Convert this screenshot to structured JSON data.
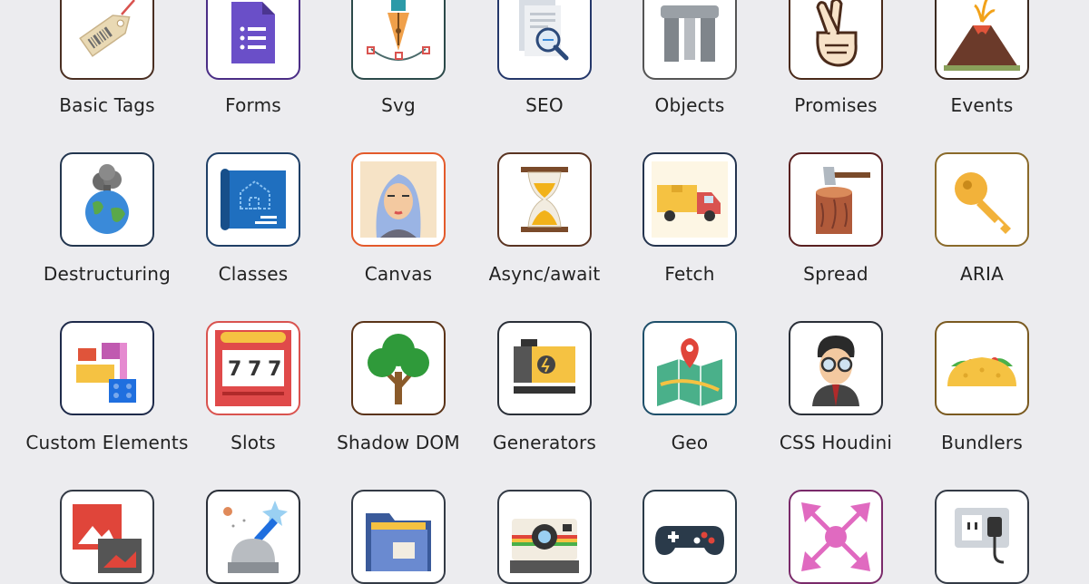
{
  "topics": [
    {
      "label": "Basic Tags",
      "icon": "price-tag-icon",
      "border": "#4a2f22"
    },
    {
      "label": "Forms",
      "icon": "form-document-icon",
      "border": "#4b2e86"
    },
    {
      "label": "Svg",
      "icon": "pen-nib-icon",
      "border": "#2c4a4a"
    },
    {
      "label": "SEO",
      "icon": "magnifier-document-icon",
      "border": "#25386a"
    },
    {
      "label": "Objects",
      "icon": "stonehenge-icon",
      "border": "#555555"
    },
    {
      "label": "Promises",
      "icon": "crossed-fingers-icon",
      "border": "#4a2a1a"
    },
    {
      "label": "Events",
      "icon": "volcano-icon",
      "border": "#3b2a20"
    },
    {
      "label": "Destructuring",
      "icon": "exploding-earth-icon",
      "border": "#23364f"
    },
    {
      "label": "Classes",
      "icon": "blueprint-icon",
      "border": "#1f3f66"
    },
    {
      "label": "Canvas",
      "icon": "portrait-painting-icon",
      "border": "#e35a2b"
    },
    {
      "label": "Async/await",
      "icon": "hourglass-icon",
      "border": "#5a3422"
    },
    {
      "label": "Fetch",
      "icon": "delivery-truck-icon",
      "border": "#24344f"
    },
    {
      "label": "Spread",
      "icon": "axe-stump-icon",
      "border": "#5a2020"
    },
    {
      "label": "ARIA",
      "icon": "key-icon",
      "border": "#8a6a2a"
    },
    {
      "label": "Custom Elements",
      "icon": "building-blocks-icon",
      "border": "#1e2a4a"
    },
    {
      "label": "Slots",
      "icon": "slot-machine-icon",
      "border": "#d9534f"
    },
    {
      "label": "Shadow DOM",
      "icon": "tree-icon",
      "border": "#5a3318"
    },
    {
      "label": "Generators",
      "icon": "power-generator-icon",
      "border": "#2a2f38"
    },
    {
      "label": "Geo",
      "icon": "map-pin-icon",
      "border": "#1e4f6a"
    },
    {
      "label": "CSS Houdini",
      "icon": "wizard-boy-icon",
      "border": "#2a2f38"
    },
    {
      "label": "Bundlers",
      "icon": "taco-icon",
      "border": "#7a5a20"
    },
    {
      "label": "",
      "icon": "picture-frames-icon",
      "border": "#333a45"
    },
    {
      "label": "",
      "icon": "observatory-icon",
      "border": "#2a2f38"
    },
    {
      "label": "",
      "icon": "folder-icon",
      "border": "#333a45"
    },
    {
      "label": "",
      "icon": "instant-camera-icon",
      "border": "#333a45"
    },
    {
      "label": "",
      "icon": "gamepad-icon",
      "border": "#2a3a48"
    },
    {
      "label": "",
      "icon": "expand-arrows-icon",
      "border": "#7a2a6a"
    },
    {
      "label": "",
      "icon": "power-socket-icon",
      "border": "#333a45"
    }
  ]
}
